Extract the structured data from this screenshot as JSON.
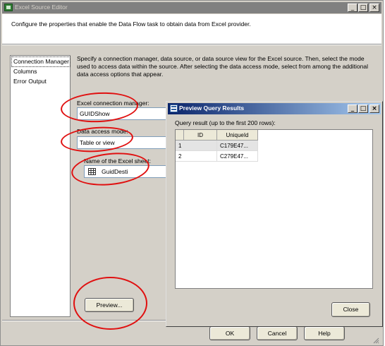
{
  "main_window": {
    "title": "Excel Source Editor",
    "description": "Configure the properties that enable the Data Flow task to obtain data from Excel provider.",
    "caption_buttons": {
      "minimize": "_",
      "maximize": "□",
      "close": "×"
    }
  },
  "nav": {
    "items": [
      {
        "label": "Connection Manager",
        "selected": true
      },
      {
        "label": "Columns",
        "selected": false
      },
      {
        "label": "Error Output",
        "selected": false
      }
    ]
  },
  "panel": {
    "instructions": "Specify a connection manager, data source, or data source view for the Excel source. Then, select the mode used to access data within the source. After selecting the data access mode, select from among the additional data access options that appear.",
    "connection_manager_label": "Excel connection manager:",
    "connection_manager_value": "GUIDShow",
    "access_mode_label": "Data access mode:",
    "access_mode_value": "Table or view",
    "sheet_label": "Name of the Excel sheet:",
    "sheet_value": "GuidDesti",
    "preview_button": "Preview..."
  },
  "footer": {
    "ok": "OK",
    "cancel": "Cancel",
    "help": "Help"
  },
  "preview_dialog": {
    "title": "Preview Query Results",
    "caption_buttons": {
      "minimize": "_",
      "maximize": "□",
      "close": "×"
    },
    "result_label": "Query result (up to the first 200 rows):",
    "columns": [
      "ID",
      "UniqueId"
    ],
    "rows": [
      [
        "1",
        "C179E47..."
      ],
      [
        "2",
        "C279E47..."
      ]
    ],
    "close_button": "Close"
  },
  "colors": {
    "annotation_circle": "#e01010",
    "active_title_start": "#0a246a",
    "inactive_title": "#808080"
  }
}
